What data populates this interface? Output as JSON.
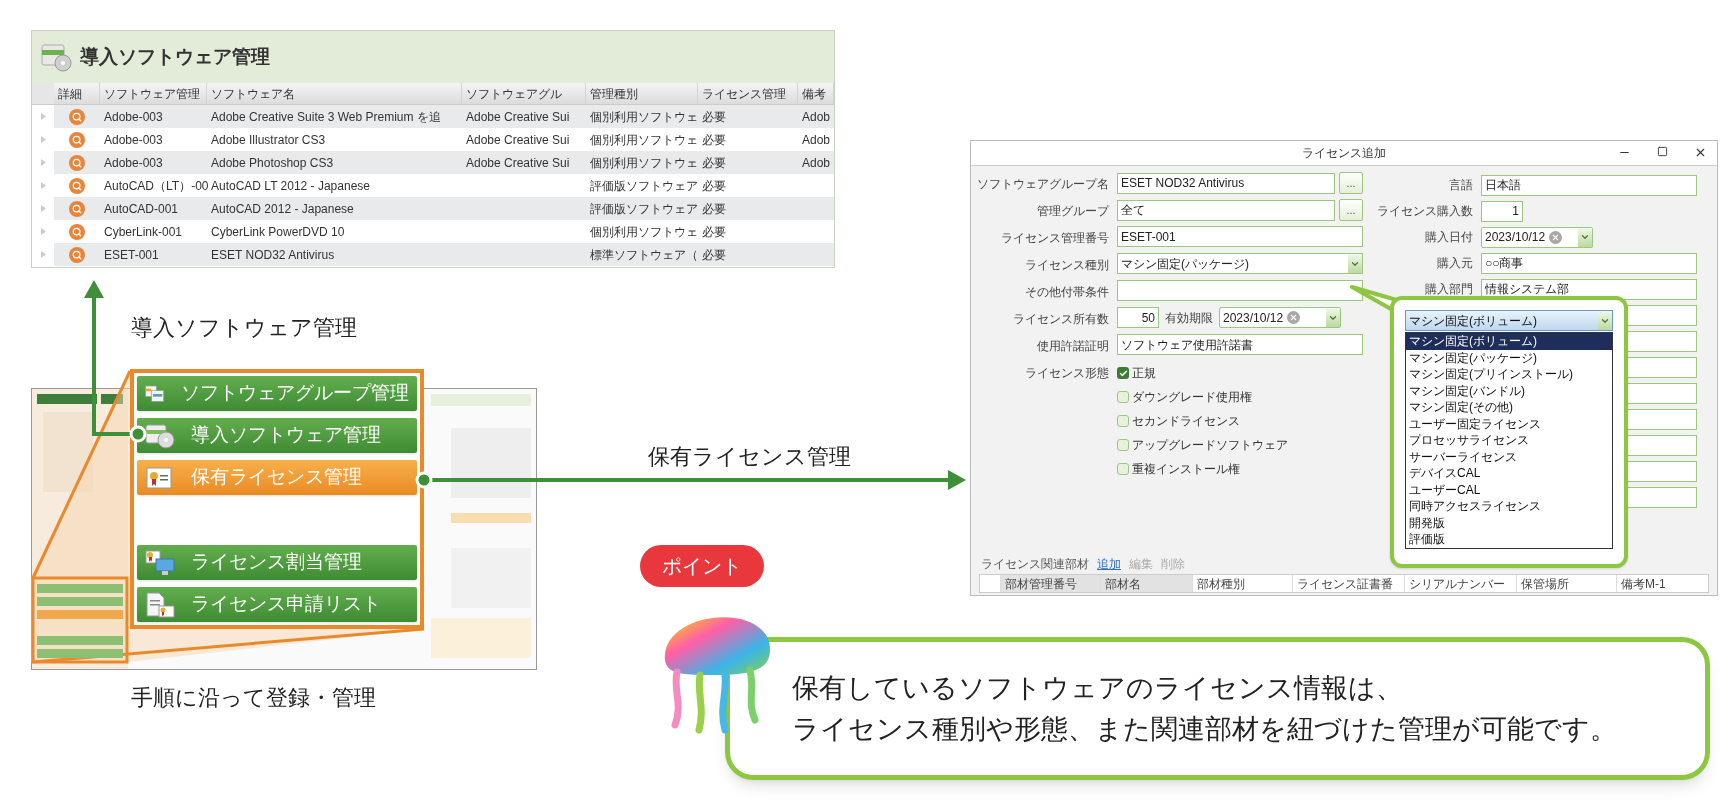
{
  "software_panel": {
    "title": "導入ソフトウェア管理",
    "columns": [
      "詳細",
      "ソフトウェア管理",
      "ソフトウェア名",
      "ソフトウェアグル",
      "管理種別",
      "ライセンス管理",
      "備考"
    ],
    "rows": [
      {
        "id": "Adobe-003",
        "name": "Adobe Creative Suite 3 Web Premium を追",
        "group": "Adobe Creative Sui",
        "type": "個別利用ソフトウェ",
        "license": "必要",
        "note": "Adob"
      },
      {
        "id": "Adobe-003",
        "name": "Adobe Illustrator CS3",
        "group": "Adobe Creative Sui",
        "type": "個別利用ソフトウェ",
        "license": "必要",
        "note": "Adob"
      },
      {
        "id": "Adobe-003",
        "name": "Adobe Photoshop CS3",
        "group": "Adobe Creative Sui",
        "type": "個別利用ソフトウェ",
        "license": "必要",
        "note": "Adob"
      },
      {
        "id": "AutoCAD（LT）-00",
        "name": "AutoCAD LT 2012 - Japanese",
        "type": "評価版ソフトウェア",
        "license": "必要"
      },
      {
        "id": "AutoCAD-001",
        "name": "AutoCAD 2012 - Japanese",
        "type": "評価版ソフトウェア",
        "license": "必要"
      },
      {
        "id": "CyberLink-001",
        "name": "CyberLink PowerDVD 10",
        "type": "個別利用ソフトウェ",
        "license": "必要"
      },
      {
        "id": "ESET-001",
        "name": "ESET NOD32 Antivirus",
        "type": "標準ソフトウェア（",
        "license": "必要"
      }
    ]
  },
  "up_arrow_label": "導入ソフトウェア管理",
  "menu": {
    "items": [
      {
        "label": "ソフトウェアグループ管理",
        "selected": false
      },
      {
        "label": "導入ソフトウェア管理",
        "selected": false
      },
      {
        "label": "保有ライセンス管理",
        "selected": true
      },
      {
        "label": "ライセンス割当管理",
        "selected": false
      },
      {
        "label": "ライセンス申請リスト",
        "selected": false
      }
    ]
  },
  "menu_caption": "手順に沿って登録・管理",
  "right_arrow_label": "保有ライセンス管理",
  "dialog": {
    "title": "ライセンス追加",
    "left_fields": [
      {
        "kind": "lookup",
        "label": "ソフトウェアグループ名",
        "value": "ESET NOD32 Antivirus",
        "button": "..."
      },
      {
        "kind": "lookup",
        "label": "管理グループ",
        "value": "全て",
        "button": "..."
      },
      {
        "kind": "text",
        "label": "ライセンス管理番号",
        "value": "ESET-001"
      },
      {
        "kind": "select",
        "label": "ライセンス種別",
        "value": "マシン固定(パッケージ)"
      },
      {
        "kind": "text",
        "label": "その他付帯条件"
      },
      {
        "kind": "count_expiry",
        "label": "ライセンス所有数",
        "value": "50",
        "second_label": "有効期限",
        "date": "2023/10/12"
      },
      {
        "kind": "text",
        "label": "使用許諾証明",
        "value": "ソフトウェア使用許諾書"
      },
      {
        "kind": "checks",
        "label": "ライセンス形態",
        "options": [
          {
            "label": "正規",
            "checked": true
          },
          {
            "label": "ダウングレード使用権",
            "checked": false
          },
          {
            "label": "セカンドライセンス",
            "checked": false
          },
          {
            "label": "アップグレードソフトウェア",
            "checked": false
          },
          {
            "label": "重複インストール権",
            "checked": false
          }
        ]
      }
    ],
    "right_fields": [
      {
        "kind": "text",
        "label": "言語",
        "value": "日本語"
      },
      {
        "kind": "number",
        "label": "ライセンス購入数",
        "value": "1"
      },
      {
        "kind": "date",
        "label": "購入日付",
        "value": "2023/10/12"
      },
      {
        "kind": "text",
        "label": "購入元",
        "value": "○○商事"
      },
      {
        "kind": "text",
        "label": "購入部門",
        "value": "情報システム部"
      },
      {
        "kind": "text"
      },
      {
        "kind": "text"
      },
      {
        "kind": "text"
      },
      {
        "kind": "text"
      },
      {
        "kind": "text"
      },
      {
        "kind": "text"
      },
      {
        "kind": "text"
      },
      {
        "kind": "text"
      }
    ],
    "parts": {
      "label": "ライセンス関連部材",
      "actions": [
        {
          "label": "追加",
          "disabled": false
        },
        {
          "label": "編集",
          "disabled": true
        },
        {
          "label": "削除",
          "disabled": true
        }
      ],
      "columns": [
        "部材管理番号",
        "部材名",
        "部材種別",
        "ライセンス証書番",
        "シリアルナンバー",
        "保管場所",
        "備考M-1"
      ]
    }
  },
  "dropdown": {
    "value": "マシン固定(ボリューム)",
    "options": [
      {
        "label": "マシン固定(ボリューム)",
        "selected": true
      },
      {
        "label": "マシン固定(パッケージ)",
        "selected": false
      },
      {
        "label": "マシン固定(プリインストール)",
        "selected": false
      },
      {
        "label": "マシン固定(バンドル)",
        "selected": false
      },
      {
        "label": "マシン固定(その他)",
        "selected": false
      },
      {
        "label": "ユーザー固定ライセンス",
        "selected": false
      },
      {
        "label": "プロセッサライセンス",
        "selected": false
      },
      {
        "label": "サーバーライセンス",
        "selected": false
      },
      {
        "label": "デバイスCAL",
        "selected": false
      },
      {
        "label": "ユーザーCAL",
        "selected": false
      },
      {
        "label": "同時アクセスライセンス",
        "selected": false
      },
      {
        "label": "開発版",
        "selected": false
      },
      {
        "label": "評価版",
        "selected": false
      }
    ]
  },
  "point_badge": "ポイント",
  "note": {
    "lines": [
      "保有しているソフトウェアのライセンス情報は、",
      "ライセンス種別や形態、また関連部材を紐づけた管理が可能です。"
    ]
  }
}
